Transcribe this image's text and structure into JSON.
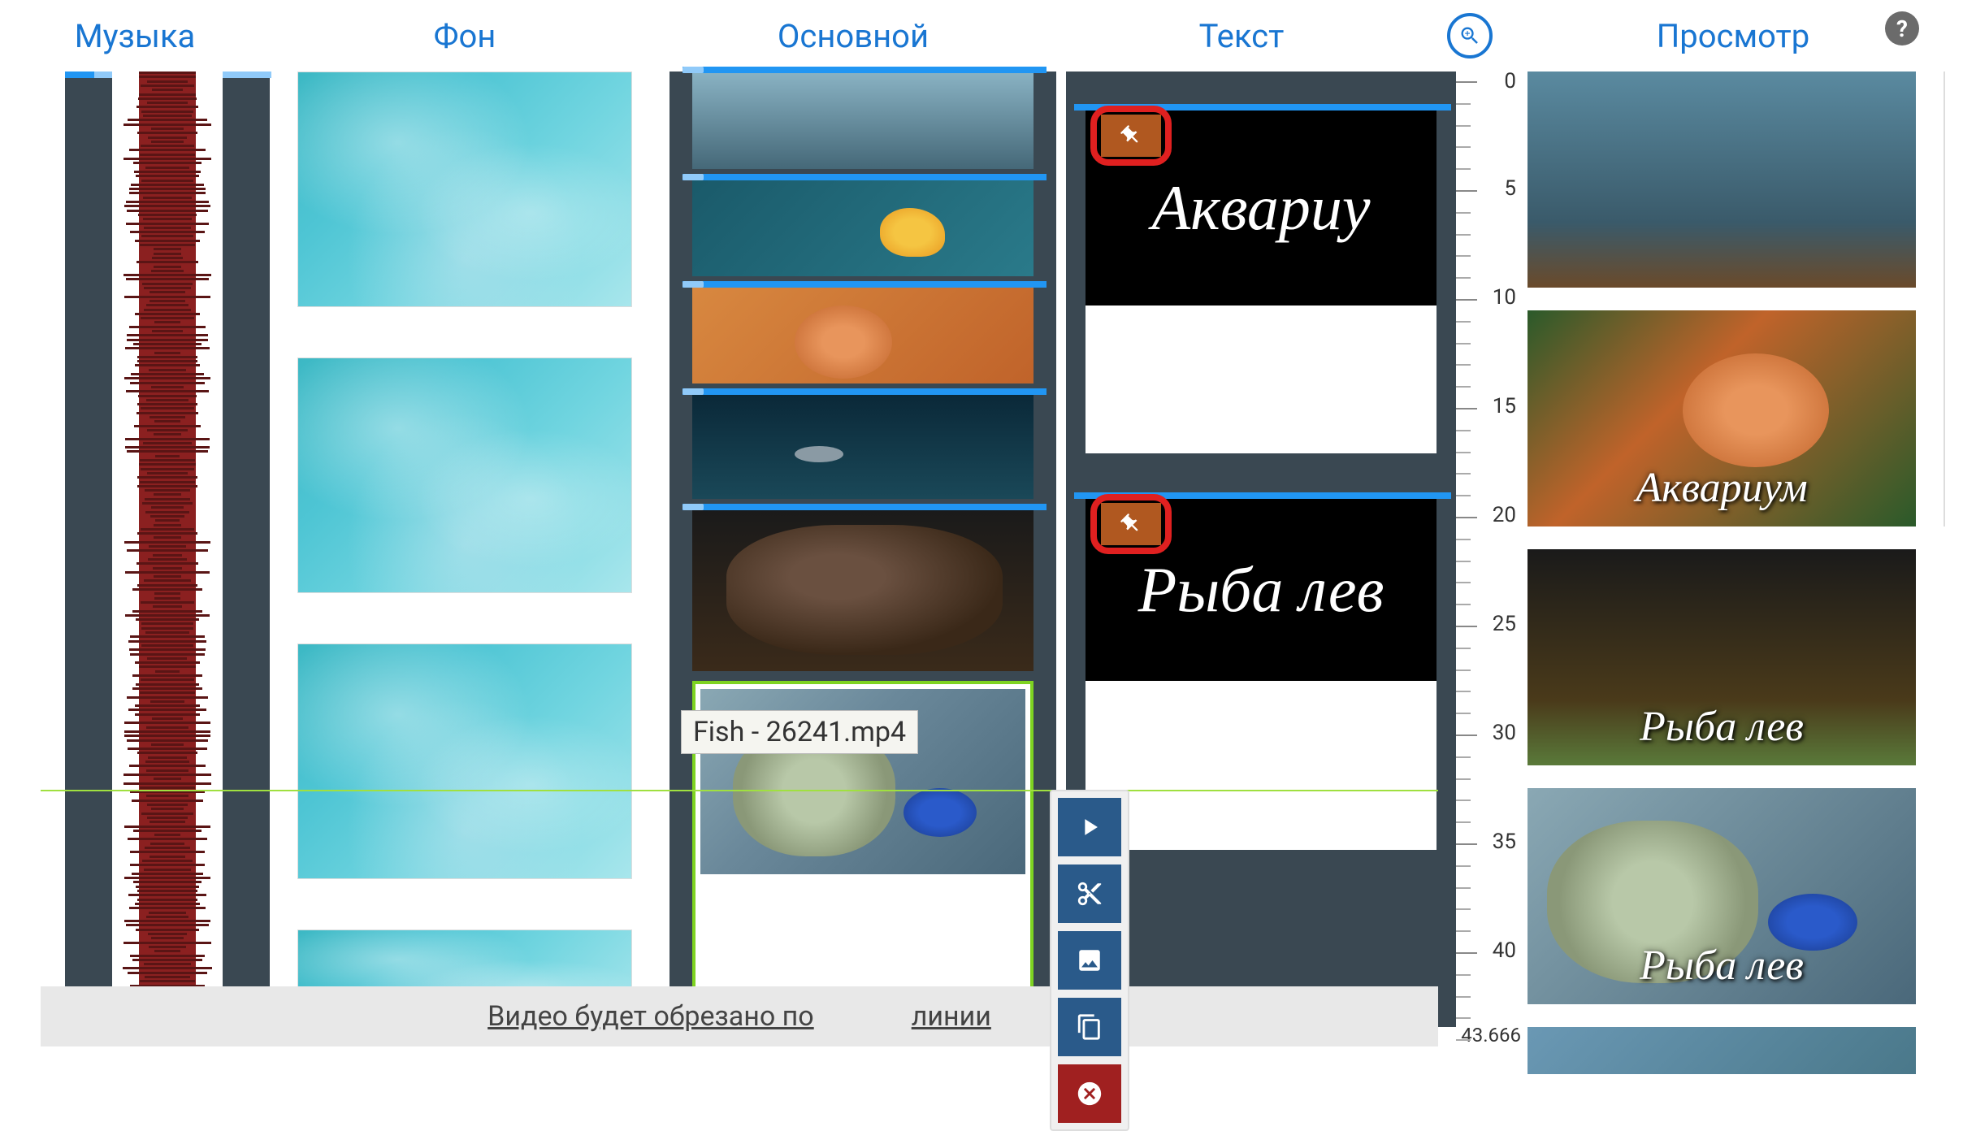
{
  "headers": {
    "music": "Музыка",
    "background": "Фон",
    "main": "Основной",
    "text": "Текст",
    "preview": "Просмотр"
  },
  "ruler": {
    "ticks": [
      0,
      5,
      10,
      15,
      20,
      25,
      30,
      35,
      40
    ],
    "end": "43.666"
  },
  "text_clips": {
    "clip1": "Аквариу",
    "clip2": "Рыба лев"
  },
  "preview_labels": {
    "thumb2": "Аквариум",
    "thumb3": "Рыба лев",
    "thumb4": "Рыба лев"
  },
  "tooltip": "Fish - 26241.mp4",
  "crop_notice_left": "Видео будет обрезано по",
  "crop_notice_right": "линии",
  "icons": {
    "zoom": "zoom-in",
    "help": "?",
    "pin": "pin",
    "play": "play",
    "cut": "scissors",
    "image": "image",
    "copy": "copy",
    "delete": "delete"
  },
  "colors": {
    "primary": "#1976d2",
    "timeline_bar": "#2196f3",
    "track_bg": "#3a4852",
    "highlight_red": "#e02020",
    "selected_green": "#7ed321",
    "playhead": "#a0e040",
    "action_blue": "#2a5a8a",
    "action_red": "#a02020"
  }
}
